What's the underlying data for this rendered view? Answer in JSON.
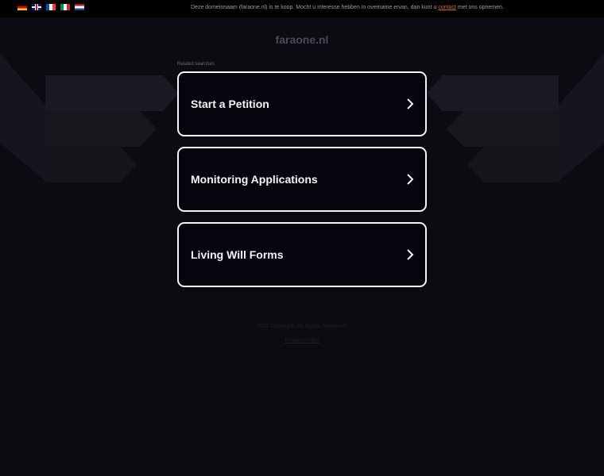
{
  "topbar": {
    "flags": [
      {
        "lang": "de",
        "icon": "german-flag-icon"
      },
      {
        "lang": "en",
        "icon": "uk-flag-icon"
      },
      {
        "lang": "fr",
        "icon": "french-flag-icon"
      },
      {
        "lang": "it",
        "icon": "italian-flag-icon"
      },
      {
        "lang": "nl",
        "icon": "dutch-flag-icon"
      }
    ],
    "notice_prefix": "Deze domeinnaam (faraone.nl) is te koop. Mocht u interesse hebben in overname ervan, dan kunt u",
    "notice_link": "contact",
    "notice_suffix": "met ons opnemen."
  },
  "header": {
    "domain": "faraone.nl",
    "related_label": "Related searches"
  },
  "cards": [
    {
      "label": "Start a Petition"
    },
    {
      "label": "Monitoring Applications"
    },
    {
      "label": "Living Will Forms"
    }
  ],
  "footer": {
    "copyright": "2022 Copyright. All Rights Reserved.",
    "privacy": "Privacy Policy"
  },
  "colors": {
    "background": "#0b0b12",
    "card_border": "#f4f4f6",
    "link_accent": "#d06a1e"
  }
}
